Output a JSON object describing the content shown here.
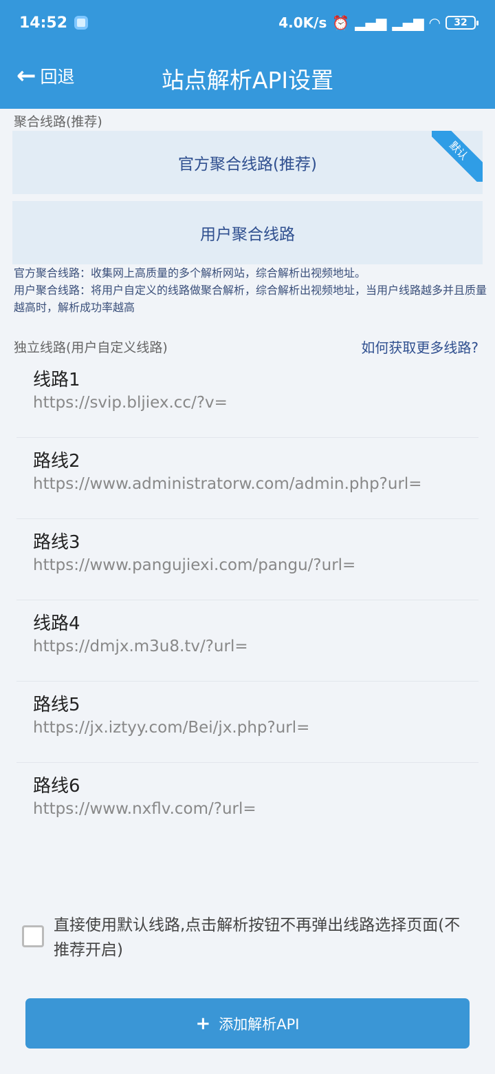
{
  "status_bar": {
    "time": "14:52",
    "speed": "4.0K/s",
    "battery": "32"
  },
  "header": {
    "back_label": "回退",
    "title": "站点解析API设置"
  },
  "aggregate": {
    "section_label": "聚合线路(推荐)",
    "official_label": "官方聚合线路(推荐)",
    "default_badge": "默认",
    "user_label": "用户聚合线路",
    "desc_official": "官方聚合线路：收集网上高质量的多个解析网站，综合解析出视频地址。",
    "desc_user": "用户聚合线路：将用户自定义的线路做聚合解析，综合解析出视频地址，当用户线路越多并且质量越高时，解析成功率越高"
  },
  "independent": {
    "section_label": "独立线路(用户自定义线路)",
    "more_link": "如何获取更多线路?",
    "items": [
      {
        "name": "线路1",
        "url": "https://svip.bljiex.cc/?v="
      },
      {
        "name": "路线2",
        "url": "https://www.administratorw.com/admin.php?url="
      },
      {
        "name": "路线3",
        "url": "https://www.pangujiexi.com/pangu/?url="
      },
      {
        "name": "线路4",
        "url": "https://dmjx.m3u8.tv/?url="
      },
      {
        "name": "路线5",
        "url": "https://jx.iztyy.com/Bei/jx.php?url="
      },
      {
        "name": "路线6",
        "url": "https://www.nxflv.com/?url="
      }
    ]
  },
  "option": {
    "checked": false,
    "text": "直接使用默认线路,点击解析按钮不再弹出线路选择页面(不推荐开启)"
  },
  "add_button": {
    "icon": "+",
    "label": "添加解析API"
  },
  "colors": {
    "primary": "#3598dc",
    "card": "#e2ecf5",
    "link": "#2f4f8f"
  }
}
